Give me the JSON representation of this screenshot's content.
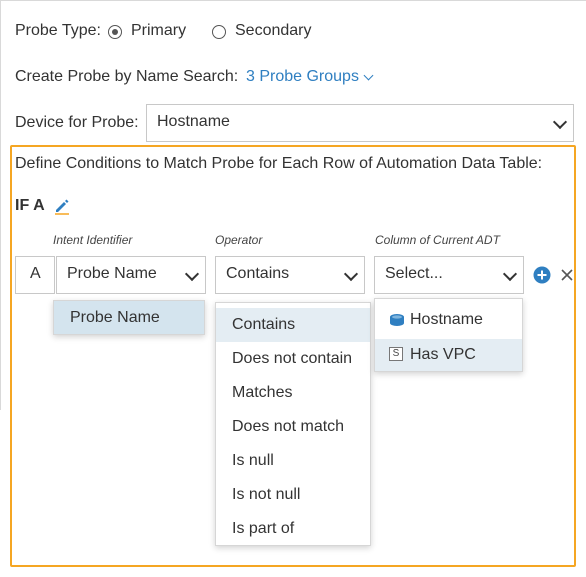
{
  "probe_type": {
    "label": "Probe Type:",
    "options": [
      {
        "label": "Primary",
        "checked": true
      },
      {
        "label": "Secondary",
        "checked": false
      }
    ]
  },
  "name_search": {
    "label": "Create Probe by Name Search:",
    "link": "3 Probe Groups"
  },
  "device": {
    "label": "Device for Probe:",
    "value": "Hostname"
  },
  "conditions": {
    "title": "Define Conditions to Match Probe for Each Row of Automation Data Table:",
    "if_label": "IF A",
    "columns": {
      "intent": "Intent Identifier",
      "operator": "Operator",
      "adt": "Column of Current ADT"
    },
    "row": {
      "id": "A",
      "intent_value": "Probe Name",
      "operator_value": "Contains",
      "adt_value": "Select..."
    },
    "intent_options": [
      "Probe Name"
    ],
    "operator_options": [
      "Contains",
      "Does not contain",
      "Matches",
      "Does not match",
      "Is null",
      "Is not null",
      "Is part of"
    ],
    "adt_options": [
      {
        "label": "Hostname",
        "icon": "database-icon"
      },
      {
        "label": "Has VPC",
        "icon": "string-type-icon",
        "icon_text": "S"
      }
    ]
  },
  "colors": {
    "accent": "#2f7fc1",
    "panel_border": "#f5a623",
    "highlight": "#e4edf3",
    "add_button": "#2f7fc1"
  }
}
